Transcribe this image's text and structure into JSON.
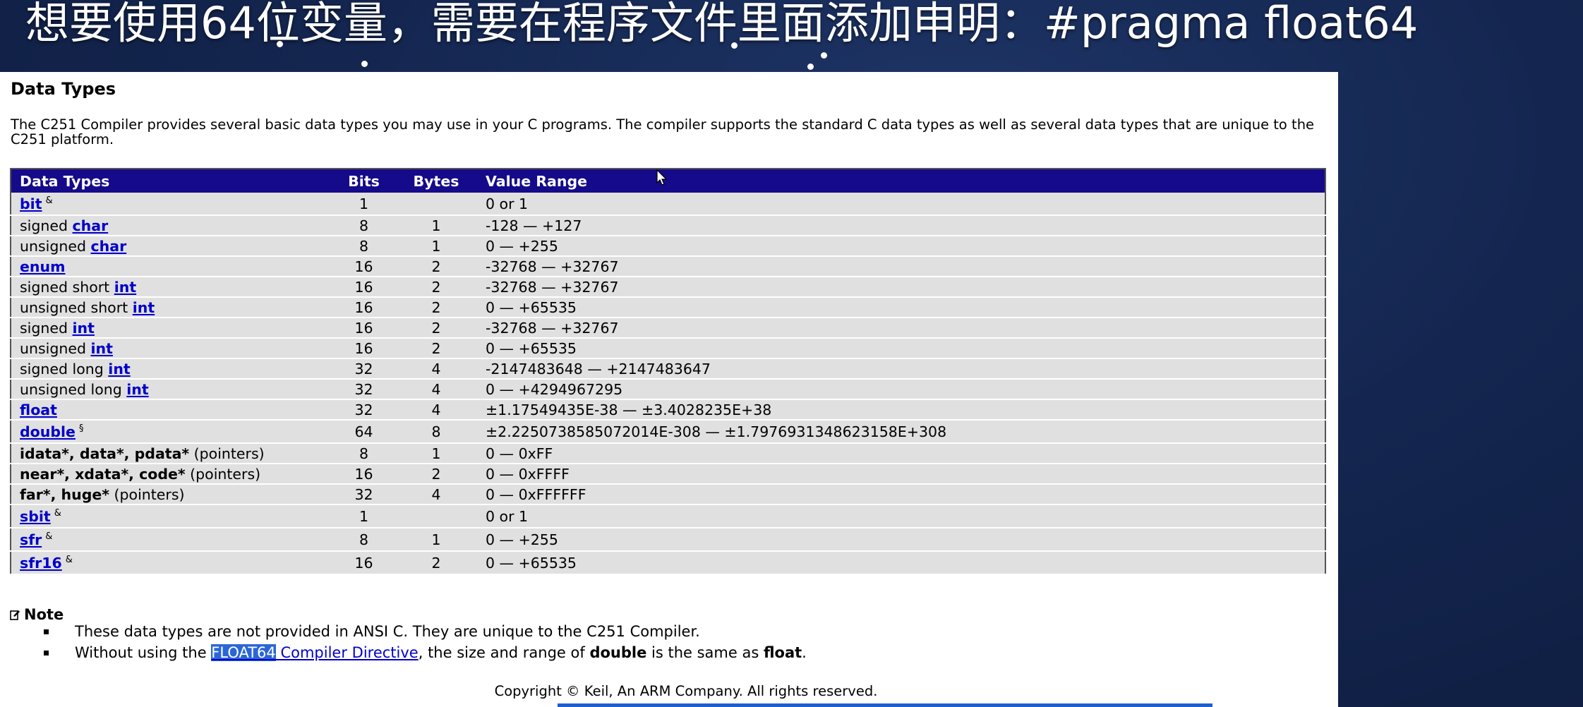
{
  "caption": "想要使用64位变量，需要在程序文件里面添加申明：#pragma float64",
  "title": "Data Types",
  "intro": "The C251 Compiler provides several basic data types you may use in your C programs. The compiler supports the standard C data types as well as several data types that are unique to the C251 platform.",
  "table": {
    "headers": [
      "Data Types",
      "Bits",
      "Bytes",
      "Value Range"
    ],
    "rows": [
      {
        "pre": "",
        "link": "bit",
        "post": "",
        "bold": "",
        "tail": "",
        "sup": "&",
        "bits": "1",
        "bytes": "",
        "range": "0 or 1"
      },
      {
        "pre": "signed ",
        "link": "char",
        "post": "",
        "bold": "",
        "tail": "",
        "sup": "",
        "bits": "8",
        "bytes": "1",
        "range": "-128 — +127"
      },
      {
        "pre": "unsigned ",
        "link": "char",
        "post": "",
        "bold": "",
        "tail": "",
        "sup": "",
        "bits": "8",
        "bytes": "1",
        "range": "0 — +255"
      },
      {
        "pre": "",
        "link": "enum",
        "post": "",
        "bold": "",
        "tail": "",
        "sup": "",
        "bits": "16",
        "bytes": "2",
        "range": "-32768 — +32767"
      },
      {
        "pre": "signed short ",
        "link": "int",
        "post": "",
        "bold": "",
        "tail": "",
        "sup": "",
        "bits": "16",
        "bytes": "2",
        "range": "-32768 — +32767"
      },
      {
        "pre": "unsigned short ",
        "link": "int",
        "post": "",
        "bold": "",
        "tail": "",
        "sup": "",
        "bits": "16",
        "bytes": "2",
        "range": "0 — +65535"
      },
      {
        "pre": "signed ",
        "link": "int",
        "post": "",
        "bold": "",
        "tail": "",
        "sup": "",
        "bits": "16",
        "bytes": "2",
        "range": "-32768 — +32767"
      },
      {
        "pre": "unsigned ",
        "link": "int",
        "post": "",
        "bold": "",
        "tail": "",
        "sup": "",
        "bits": "16",
        "bytes": "2",
        "range": "0 — +65535"
      },
      {
        "pre": "signed long ",
        "link": "int",
        "post": "",
        "bold": "",
        "tail": "",
        "sup": "",
        "bits": "32",
        "bytes": "4",
        "range": "-2147483648 — +2147483647"
      },
      {
        "pre": "unsigned long ",
        "link": "int",
        "post": "",
        "bold": "",
        "tail": "",
        "sup": "",
        "bits": "32",
        "bytes": "4",
        "range": "0 — +4294967295"
      },
      {
        "pre": "",
        "link": "float",
        "post": "",
        "bold": "",
        "tail": "",
        "sup": "",
        "bits": "32",
        "bytes": "4",
        "range": "±1.17549435E-38 — ±3.4028235E+38"
      },
      {
        "pre": "",
        "link": "double",
        "post": "",
        "bold": "",
        "tail": "",
        "sup": "§",
        "bits": "64",
        "bytes": "8",
        "range": "±2.2250738585072014E-308 — ±1.7976931348623158E+308"
      },
      {
        "pre": "",
        "link": "",
        "post": "",
        "bold": "idata*, data*, pdata*",
        "tail": " (pointers)",
        "sup": "",
        "bits": "8",
        "bytes": "1",
        "range": "0 — 0xFF"
      },
      {
        "pre": "",
        "link": "",
        "post": "",
        "bold": "near*, xdata*, code*",
        "tail": " (pointers)",
        "sup": "",
        "bits": "16",
        "bytes": "2",
        "range": "0 — 0xFFFF"
      },
      {
        "pre": "",
        "link": "",
        "post": "",
        "bold": "far*, huge*",
        "tail": " (pointers)",
        "sup": "",
        "bits": "32",
        "bytes": "4",
        "range": "0 — 0xFFFFFF"
      },
      {
        "pre": "",
        "link": "sbit",
        "post": "",
        "bold": "",
        "tail": "",
        "sup": "&",
        "bits": "1",
        "bytes": "",
        "range": "0 or 1"
      },
      {
        "pre": "",
        "link": "sfr",
        "post": "",
        "bold": "",
        "tail": "",
        "sup": "&",
        "bits": "8",
        "bytes": "1",
        "range": "0 — +255"
      },
      {
        "pre": "",
        "link": "sfr16",
        "post": "",
        "bold": "",
        "tail": "",
        "sup": "&",
        "bits": "16",
        "bytes": "2",
        "range": "0 — +65535"
      }
    ]
  },
  "note": {
    "heading": "Note",
    "item1": "These data types are not provided in ANSI C. They are unique to the C251 Compiler.",
    "item2_pre": "Without using the ",
    "item2_highlight": "FLOAT64",
    "item2_link": " Compiler Directive",
    "item2_mid": ", the size and range of ",
    "item2_bold1": "double",
    "item2_mid2": " is the same as ",
    "item2_bold2": "float",
    "item2_end": "."
  },
  "copyright": "Copyright © Keil, An ARM Company. All rights reserved.",
  "colors": {
    "header_bg": "#150a8a",
    "row_bg": "#e0e0e0",
    "link": "#0000cc",
    "highlight": "#2a66d6",
    "slide_bg": "#142650"
  }
}
